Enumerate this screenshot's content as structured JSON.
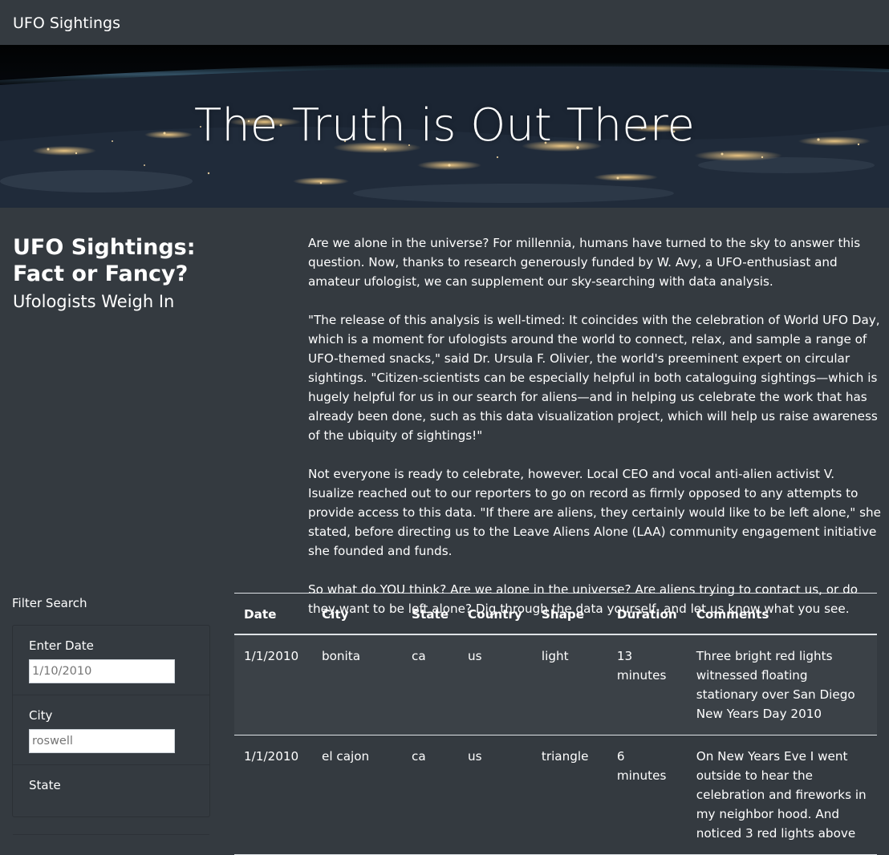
{
  "navbar": {
    "brand": "UFO Sightings"
  },
  "hero": {
    "title": "The Truth is Out There"
  },
  "headline": {
    "main": "UFO Sightings: Fact or Fancy?",
    "sub": "Ufologists Weigh In"
  },
  "article": {
    "paragraphs": [
      "Are we alone in the universe? For millennia, humans have turned to the sky to answer this question. Now, thanks to research generously funded by W. Avy, a UFO-enthusiast and amateur ufologist, we can supplement our sky-searching with data analysis.",
      "\"The release of this analysis is well-timed: It coincides with the celebration of World UFO Day, which is a moment for ufologists around the world to connect, relax, and sample a range of UFO-themed snacks,\" said Dr. Ursula F. Olivier, the world's preeminent expert on circular sightings. \"Citizen-scientists can be especially helpful in both cataloguing sightings—which is hugely helpful for us in our search for aliens—and in helping us celebrate the work that has already been done, such as this data visualization project, which will help us raise awareness of the ubiquity of sightings!\"",
      "Not everyone is ready to celebrate, however. Local CEO and vocal anti-alien activist V. Isualize reached out to our reporters to go on record as firmly opposed to any attempts to provide access to this data. \"If there are aliens, they certainly would like to be left alone,\" she stated, before directing us to the Leave Aliens Alone (LAA) community engagement initiative she founded and funds.",
      "So what do YOU think? Are we alone in the universe? Are aliens trying to contact us, or do they want to be left alone? Dig through the data yourself, and let us know what you see."
    ]
  },
  "filters": {
    "title": "Filter Search",
    "date": {
      "label": "Enter Date",
      "placeholder": "1/10/2010"
    },
    "city": {
      "label": "City",
      "placeholder": "roswell"
    },
    "state": {
      "label": "State"
    }
  },
  "table": {
    "headers": [
      "Date",
      "City",
      "State",
      "Country",
      "Shape",
      "Duration",
      "Comments"
    ],
    "rows": [
      [
        "1/1/2010",
        "bonita",
        "ca",
        "us",
        "light",
        "13 minutes",
        "Three bright red lights witnessed floating stationary over San Diego New Years Day 2010"
      ],
      [
        "1/1/2010",
        "el cajon",
        "ca",
        "us",
        "triangle",
        "6 minutes",
        "On New Years Eve I went outside to hear the celebration and fireworks in my neighbor hood. And noticed 3 red lights above"
      ]
    ]
  }
}
